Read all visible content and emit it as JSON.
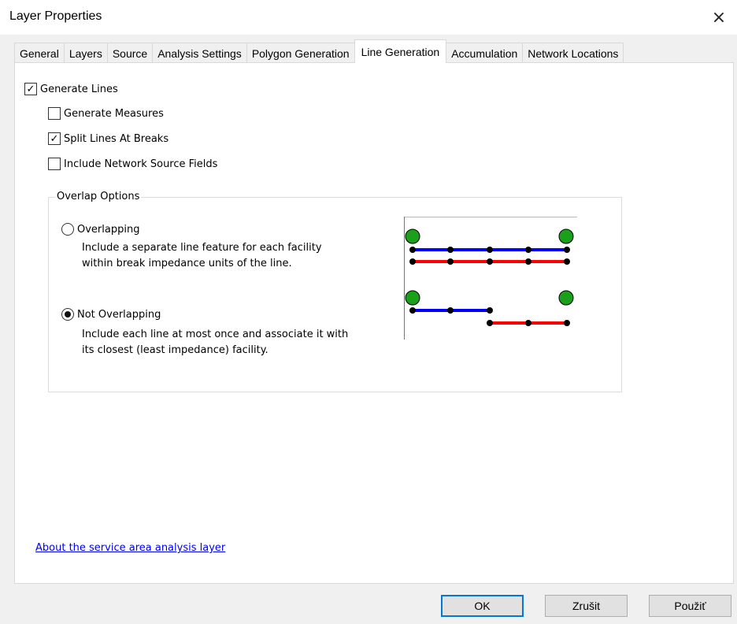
{
  "window": {
    "title": "Layer Properties",
    "close_glyph": "×"
  },
  "tabs": [
    {
      "label": "General"
    },
    {
      "label": "Layers"
    },
    {
      "label": "Source"
    },
    {
      "label": "Analysis Settings"
    },
    {
      "label": "Polygon Generation"
    },
    {
      "label": "Line Generation",
      "active": true
    },
    {
      "label": "Accumulation"
    },
    {
      "label": "Network Locations"
    }
  ],
  "options": {
    "generate_lines": {
      "label": "Generate Lines",
      "checked": true
    },
    "generate_measures": {
      "label": "Generate Measures",
      "checked": false
    },
    "split_lines": {
      "label": "Split Lines At Breaks",
      "checked": true
    },
    "include_source_fields": {
      "label": "Include Network Source Fields",
      "checked": false
    }
  },
  "overlap": {
    "legend": "Overlap Options",
    "overlapping": {
      "label": "Overlapping",
      "selected": false,
      "desc_line1": "Include a separate line feature for each facility",
      "desc_line2": "within break impedance units of the line."
    },
    "not_overlapping": {
      "label": "Not Overlapping",
      "selected": true,
      "desc_line1": "Include each line at most once and associate it with",
      "desc_line2": "its closest (least impedance) facility."
    }
  },
  "link": {
    "label": "About the service area analysis layer"
  },
  "buttons": {
    "ok": "OK",
    "cancel": "Zrušit",
    "apply": "Použiť"
  },
  "colors": {
    "facility": "#1aa01a",
    "line_blue": "#0000ff",
    "line_red": "#ff0000",
    "accent": "#0078d7"
  },
  "icons": {
    "check": "✓"
  }
}
